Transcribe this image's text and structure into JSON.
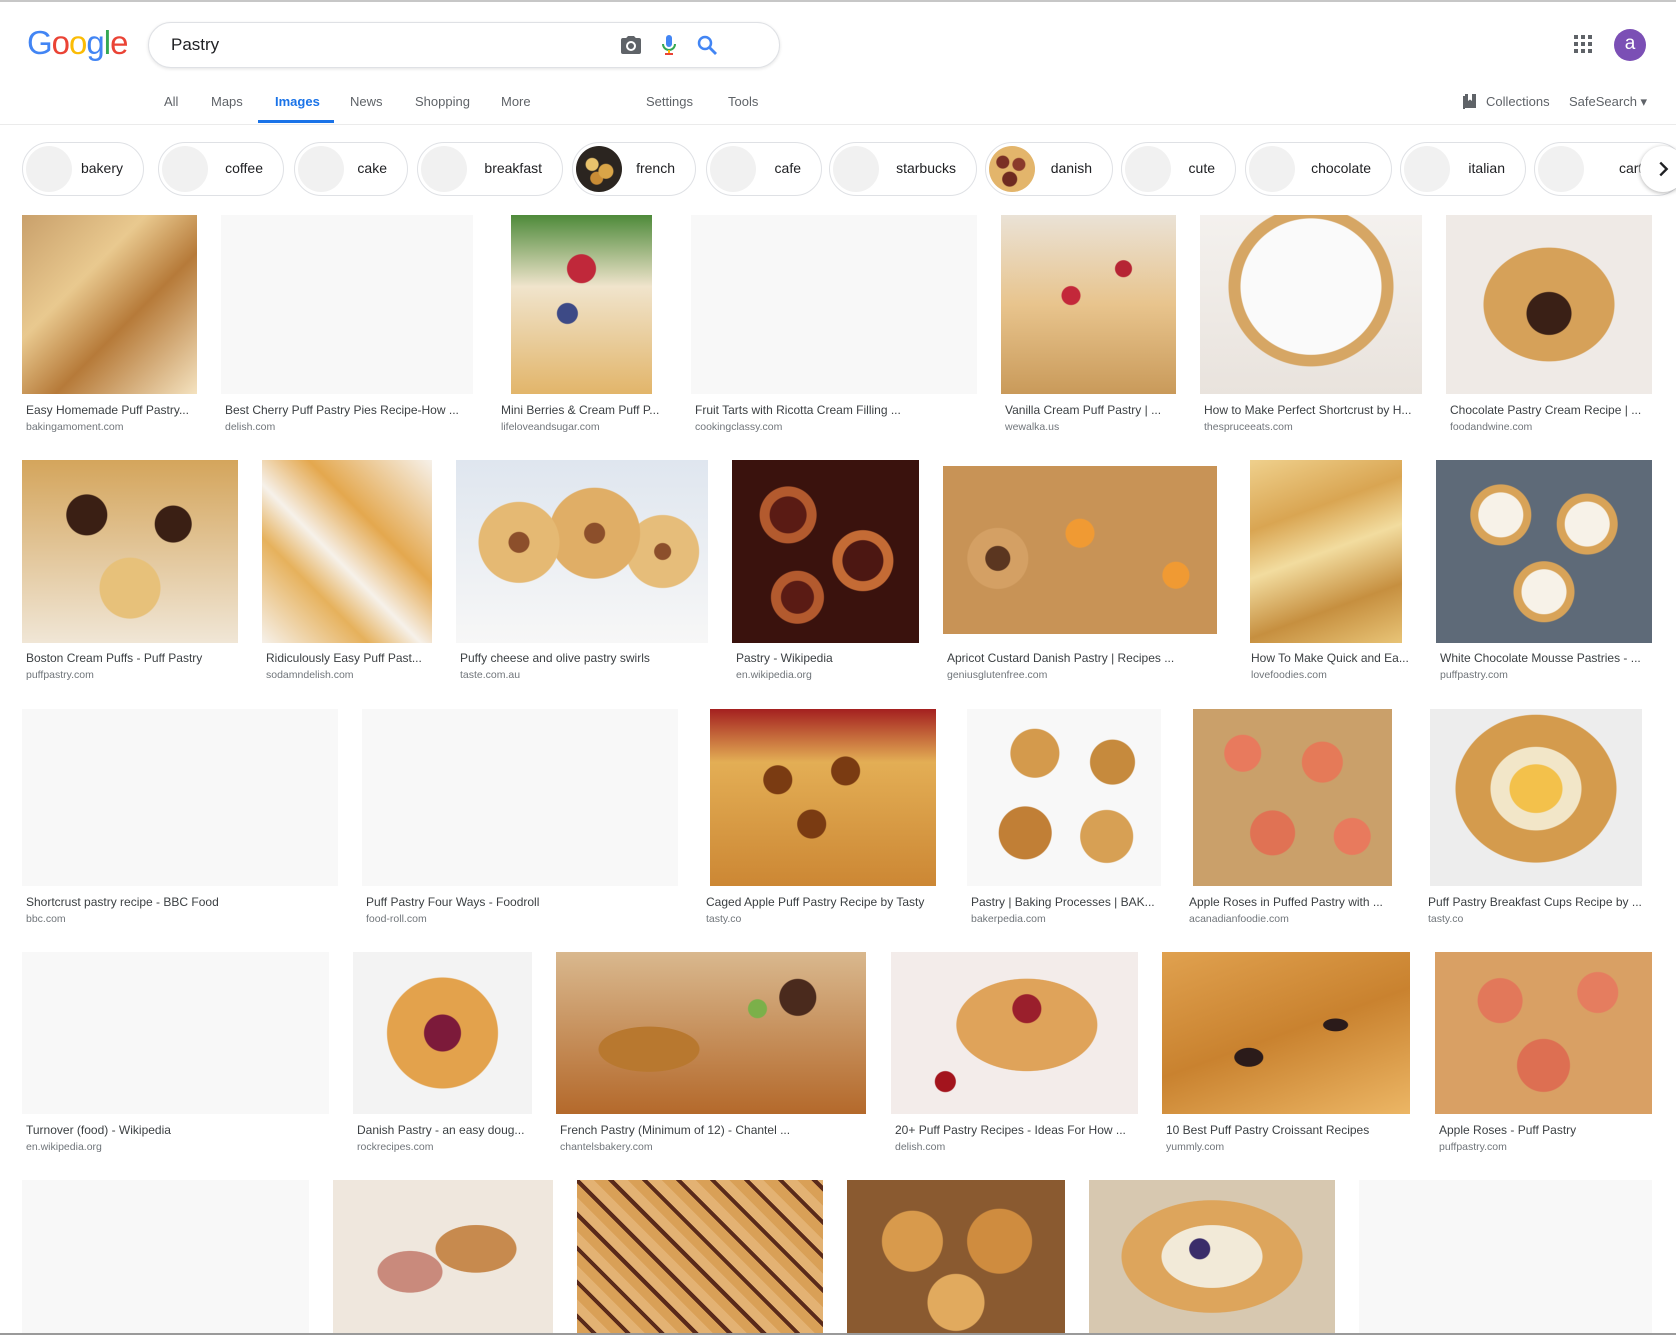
{
  "search": {
    "query": "Pastry"
  },
  "tabs": [
    "All",
    "Maps",
    "Images",
    "News",
    "Shopping",
    "More",
    "Settings",
    "Tools"
  ],
  "header": {
    "collections": "Collections",
    "safesearch": "SafeSearch ▾",
    "avatar": "a"
  },
  "chips": [
    "bakery",
    "coffee",
    "cake",
    "breakfast",
    "french",
    "cafe",
    "starbucks",
    "danish",
    "cute",
    "chocolate",
    "italian",
    "cartoo"
  ],
  "results": [
    {
      "title": "Easy Homemade Puff Pastry...",
      "site": "bakingamoment.com"
    },
    {
      "title": "Best Cherry Puff Pastry Pies Recipe-How ...",
      "site": "delish.com"
    },
    {
      "title": "Mini Berries & Cream Puff P...",
      "site": "lifeloveandsugar.com"
    },
    {
      "title": "Fruit Tarts with Ricotta Cream Filling ...",
      "site": "cookingclassy.com"
    },
    {
      "title": "Vanilla Cream Puff Pastry | ...",
      "site": "wewalka.us"
    },
    {
      "title": "How to Make Perfect Shortcrust by H...",
      "site": "thespruceeats.com"
    },
    {
      "title": "Chocolate Pastry Cream Recipe | ...",
      "site": "foodandwine.com"
    },
    {
      "title": "Boston Cream Puffs - Puff Pastry",
      "site": "puffpastry.com"
    },
    {
      "title": "Ridiculously Easy Puff Past...",
      "site": "sodamndelish.com"
    },
    {
      "title": "Puffy cheese and olive pastry swirls",
      "site": "taste.com.au"
    },
    {
      "title": "Pastry - Wikipedia",
      "site": "en.wikipedia.org"
    },
    {
      "title": "Apricot Custard Danish Pastry | Recipes ...",
      "site": "geniusglutenfree.com"
    },
    {
      "title": "How To Make Quick and Ea...",
      "site": "lovefoodies.com"
    },
    {
      "title": "White Chocolate Mousse Pastries - ...",
      "site": "puffpastry.com"
    },
    {
      "title": "Shortcrust pastry recipe - BBC Food",
      "site": "bbc.com"
    },
    {
      "title": "Puff Pastry Four Ways - Foodroll",
      "site": "food-roll.com"
    },
    {
      "title": "Caged Apple Puff Pastry Recipe by Tasty",
      "site": "tasty.co"
    },
    {
      "title": "Pastry | Baking Processes | BAK...",
      "site": "bakerpedia.com"
    },
    {
      "title": "Apple Roses in Puffed Pastry with ...",
      "site": "acanadianfoodie.com"
    },
    {
      "title": "Puff Pastry Breakfast Cups Recipe by ...",
      "site": "tasty.co"
    },
    {
      "title": "Turnover (food) - Wikipedia",
      "site": "en.wikipedia.org"
    },
    {
      "title": "Danish Pastry - an easy doug...",
      "site": "rockrecipes.com"
    },
    {
      "title": "French Pastry (Minimum of 12) - Chantel ...",
      "site": "chantelsbakery.com"
    },
    {
      "title": "20+ Puff Pastry Recipes - Ideas For How ...",
      "site": "delish.com"
    },
    {
      "title": "10 Best Puff Pastry Croissant Recipes",
      "site": "yummly.com"
    },
    {
      "title": "Apple Roses - Puff Pastry",
      "site": "puffpastry.com"
    }
  ],
  "colors": {
    "accent": "#1a73e8",
    "avatar": "#7b4fb5"
  }
}
